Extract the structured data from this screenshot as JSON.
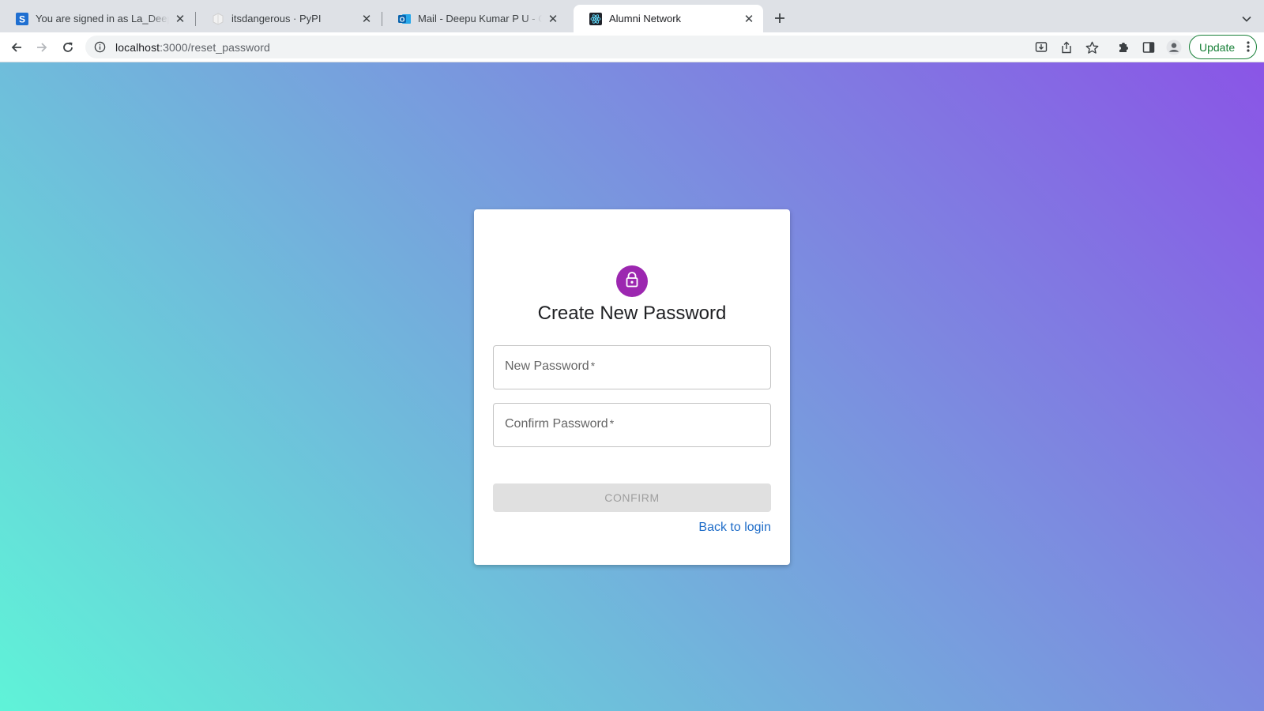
{
  "browser": {
    "tabs": [
      {
        "title": "You are signed in as La_Deepu",
        "icon": "s-logo-icon",
        "active": false
      },
      {
        "title": "itsdangerous · PyPI",
        "icon": "pypi-icon",
        "active": false
      },
      {
        "title": "Mail - Deepu Kumar P U - Outlook",
        "icon": "outlook-icon",
        "active": false
      },
      {
        "title": "Alumni Network",
        "icon": "react-icon",
        "active": true
      }
    ],
    "url_host": "localhost",
    "url_path": ":3000/reset_password",
    "update_label": "Update"
  },
  "card": {
    "title": "Create New Password",
    "new_password_label": "New Password",
    "confirm_password_label": "Confirm Password",
    "required_marker": "*",
    "confirm_button": "CONFIRM",
    "back_link": "Back to login"
  },
  "colors": {
    "avatar": "#9c27b0",
    "link": "#1e6cc8",
    "gradient_start": "#5ff3d8",
    "gradient_end": "#8a55e6"
  }
}
